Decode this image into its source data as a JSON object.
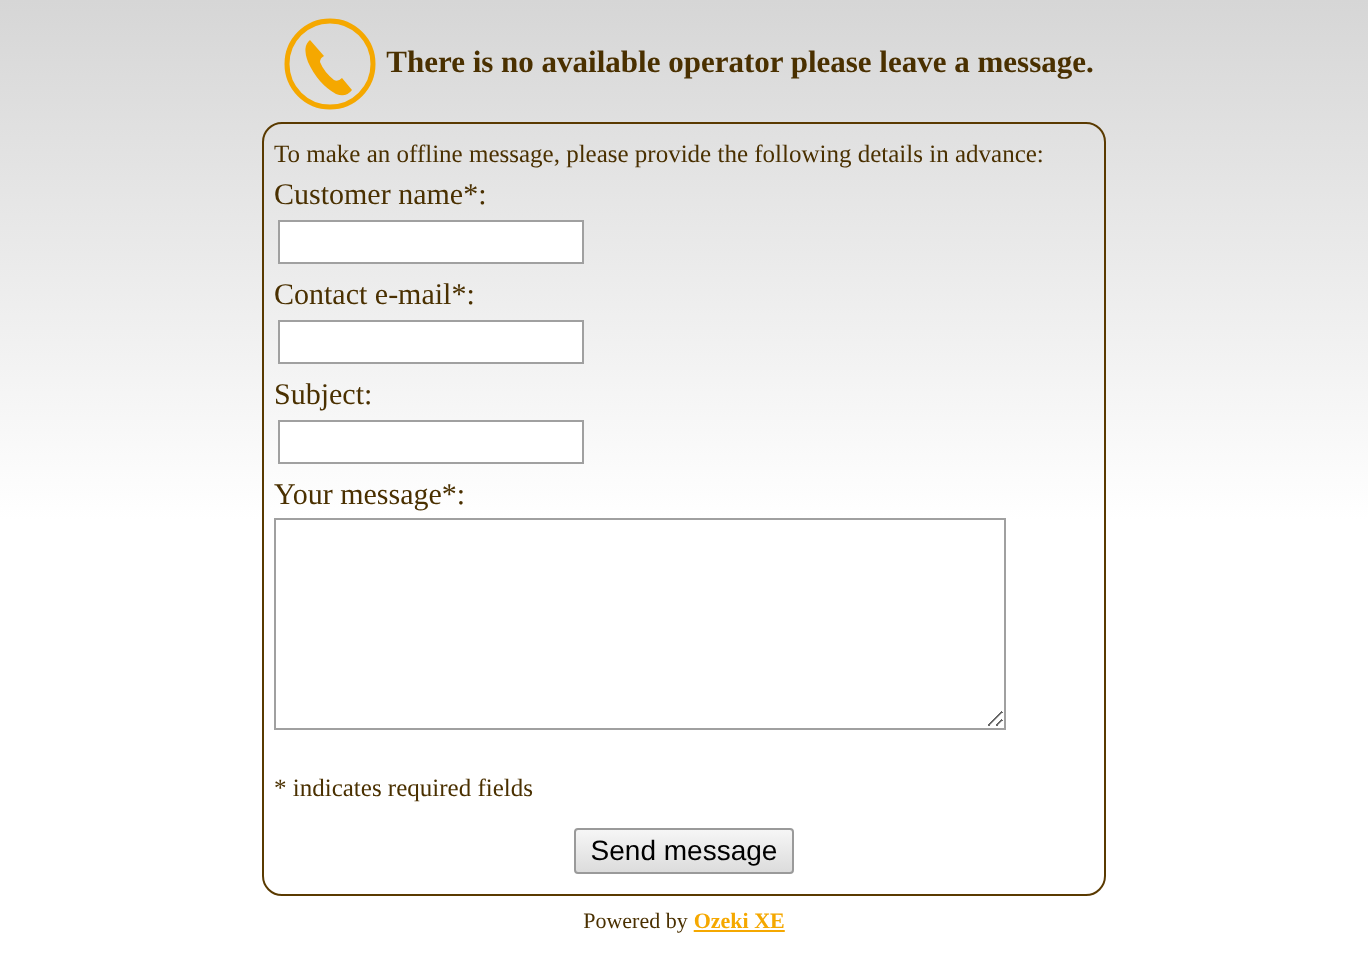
{
  "header": {
    "title": "There is no available operator please leave a message."
  },
  "form": {
    "intro": "To make an offline message, please provide the following details in advance:",
    "fields": [
      {
        "label": "Customer name*:",
        "kind": "text"
      },
      {
        "label": "Contact e-mail*:",
        "kind": "text"
      },
      {
        "label": "Subject:",
        "kind": "text"
      },
      {
        "label": "Your message*:",
        "kind": "textarea"
      }
    ],
    "note": "* indicates required fields",
    "button": "Send message"
  },
  "footer": {
    "text": "Powered by",
    "link": "Ozeki XE"
  }
}
